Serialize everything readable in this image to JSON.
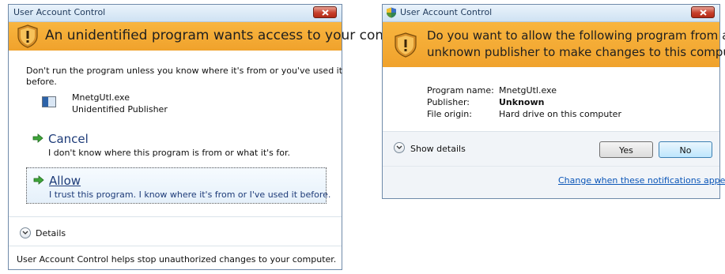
{
  "dialog1": {
    "title": "User Account Control",
    "banner": "An unidentified program wants access to your computer",
    "warning_line1": "Don't run the program unless you know where it's from or you've used it",
    "warning_line2": "before.",
    "program_name": "MnetgUtl.exe",
    "publisher": "Unidentified Publisher",
    "cancel_title": "Cancel",
    "cancel_desc": "I don't know where this program is from or what it's for.",
    "allow_title": "Allow",
    "allow_desc": "I trust this program. I know where it's from or I've used it before.",
    "details_label": "Details",
    "footer_text": "User Account Control helps stop unauthorized changes to your computer."
  },
  "dialog2": {
    "title": "User Account Control",
    "banner_line1": "Do you want to allow the following program from an",
    "banner_line2": "unknown publisher to make changes to this computer?",
    "program_name_label": "Program name:",
    "program_name_value": "MnetgUtl.exe",
    "publisher_label": "Publisher:",
    "publisher_value": "Unknown",
    "file_origin_label": "File origin:",
    "file_origin_value": "Hard drive on this computer",
    "show_details_label": "Show details",
    "yes_label": "Yes",
    "no_label": "No",
    "change_link": "Change when these notifications appear"
  },
  "colors": {
    "banner": "#f0a22c",
    "link": "#0b56b8",
    "option_title": "#1d3b78"
  }
}
